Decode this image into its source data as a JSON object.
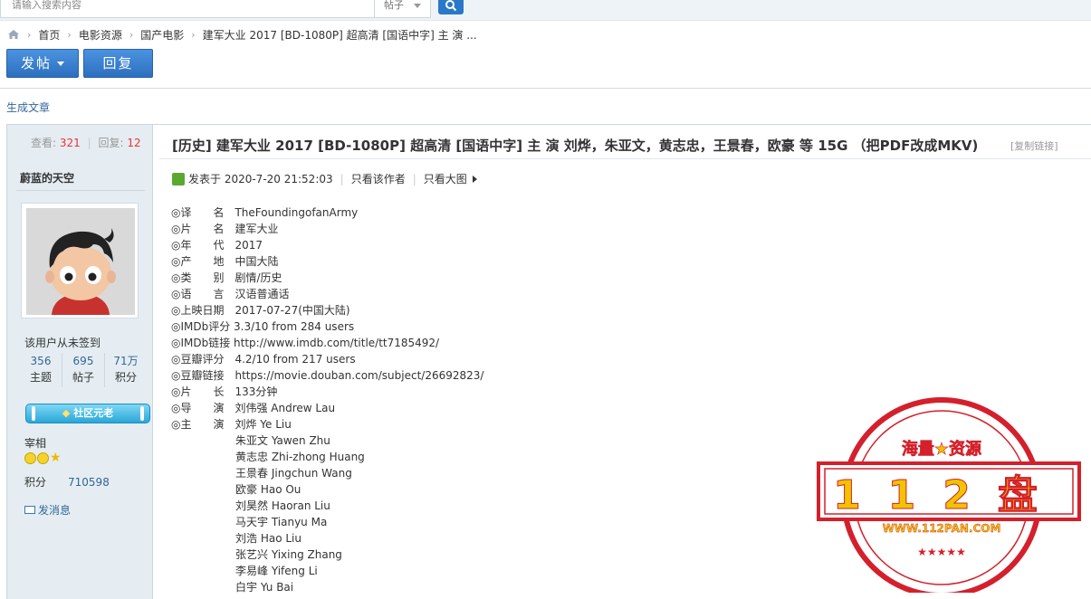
{
  "search": {
    "placeholder": "请输入搜索内容",
    "type_label": "帖子"
  },
  "breadcrumb": {
    "items": [
      "首页",
      "电影资源",
      "国产电影",
      "建军大业 2017 [BD-1080P] 超高清 [国语中字] 主 演 ..."
    ]
  },
  "toolbar": {
    "post_label": "发帖",
    "reply_label": "回复"
  },
  "generate_article": "生成文章",
  "sidebar": {
    "views_label": "查看:",
    "views": "321",
    "replies_label": "回复:",
    "replies": "12",
    "username": "蔚蓝的天空",
    "signin_status": "该用户从未签到",
    "stats": [
      {
        "value": "356",
        "label": "主题"
      },
      {
        "value": "695",
        "label": "帖子"
      },
      {
        "value": "71万",
        "label": "积分"
      }
    ],
    "medal": "社区元老",
    "rank": "宰相",
    "points_label": "积分",
    "points": "710598",
    "message": "发消息"
  },
  "post": {
    "title": "[历史] 建军大业 2017 [BD-1080P] 超高清 [国语中字] 主 演 刘烨，朱亚文，黄志忠，王景春，欧豪 等 15G （把PDF改成MKV)",
    "copy_link": "[复制链接]",
    "posted_at": "发表于 2020-7-20 21:52:03",
    "only_author": "只看该作者",
    "big_image": "只看大图",
    "info_rows": [
      "◎译　　名　TheFoundingofanArmy",
      "◎片　　名　建军大业",
      "◎年　　代　2017",
      "◎产　　地　中国大陆",
      "◎类　　别　剧情/历史",
      "◎语　　言　汉语普通话",
      "◎上映日期　2017-07-27(中国大陆)",
      "◎IMDb评分  3.3/10 from 284 users",
      "◎IMDb链接  http://www.imdb.com/title/tt7185492/",
      "◎豆瓣评分　4.2/10 from 217 users",
      "◎豆瓣链接　https://movie.douban.com/subject/26692823/",
      "◎片　　长　133分钟",
      "◎导　　演　刘伟强 Andrew Lau",
      "◎主　　演　刘烨 Ye Liu"
    ],
    "cast": [
      "朱亚文 Yawen Zhu",
      "黄志忠 Zhi-zhong Huang",
      "王景春 Jingchun Wang",
      "欧豪 Hao Ou",
      "刘昊然 Haoran Liu",
      "马天宇 Tianyu Ma",
      "刘浩 Hao Liu",
      "张艺兴 Yixing Zhang",
      "李易峰 Yifeng Li",
      "白宇 Yu Bai"
    ]
  },
  "watermark": {
    "top": "海量★资源",
    "main": "112盘",
    "url": "WWW.112PAN.COM",
    "color": "#d4202c"
  }
}
